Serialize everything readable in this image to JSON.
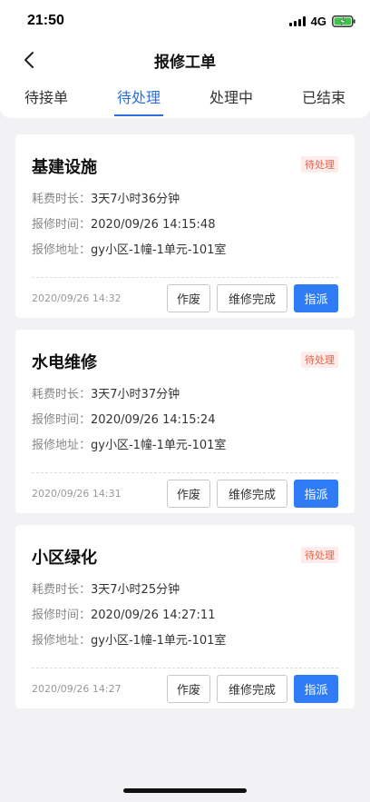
{
  "status_bar": {
    "time": "21:50",
    "network": "4G"
  },
  "header": {
    "title": "报修工单"
  },
  "tabs": [
    {
      "label": "待接单",
      "active": false
    },
    {
      "label": "待处理",
      "active": true
    },
    {
      "label": "处理中",
      "active": false
    },
    {
      "label": "已结束",
      "active": false
    }
  ],
  "labels": {
    "duration": "耗费时长：",
    "report_time": "报修时间：",
    "address": "报修地址："
  },
  "buttons": {
    "void": "作废",
    "done": "维修完成",
    "assign": "指派"
  },
  "colors": {
    "accent": "#2f7cf6",
    "status": "#e0644e"
  },
  "orders": [
    {
      "title": "基建设施",
      "status": "待处理",
      "duration": "3天7小时36分钟",
      "report_time": "2020/09/26 14:15:48",
      "address": "gy小区-1幢-1单元-101室",
      "timestamp": "2020/09/26 14:32"
    },
    {
      "title": "水电维修",
      "status": "待处理",
      "duration": "3天7小时37分钟",
      "report_time": "2020/09/26 14:15:24",
      "address": "gy小区-1幢-1单元-101室",
      "timestamp": "2020/09/26 14:31"
    },
    {
      "title": "小区绿化",
      "status": "待处理",
      "duration": "3天7小时25分钟",
      "report_time": "2020/09/26 14:27:11",
      "address": "gy小区-1幢-1单元-101室",
      "timestamp": "2020/09/26 14:27"
    }
  ]
}
